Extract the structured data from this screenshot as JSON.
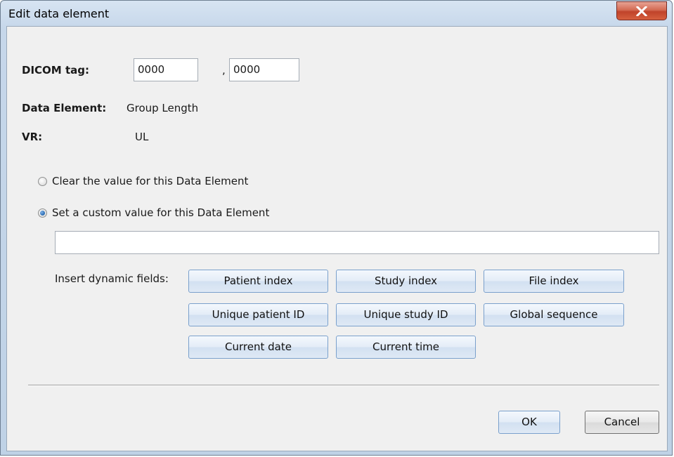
{
  "window": {
    "title": "Edit data element",
    "close_icon": "close-x-icon"
  },
  "tag": {
    "label": "DICOM tag:",
    "group": "0000",
    "separator": ",",
    "element": "0000"
  },
  "data_element": {
    "label": "Data Element:",
    "value": "Group Length"
  },
  "vr": {
    "label": "VR:",
    "value": "UL"
  },
  "options": {
    "clear_label": "Clear the value for this Data Element",
    "clear_selected": false,
    "custom_label": "Set a custom value for this Data Element",
    "custom_selected": true,
    "custom_value": ""
  },
  "dynamic_fields": {
    "label": "Insert dynamic fields:",
    "buttons": [
      "Patient index",
      "Study index",
      "File index",
      "Unique patient ID",
      "Unique study ID",
      "Global sequence",
      "Current date",
      "Current time"
    ]
  },
  "footer": {
    "ok_label": "OK",
    "cancel_label": "Cancel"
  }
}
